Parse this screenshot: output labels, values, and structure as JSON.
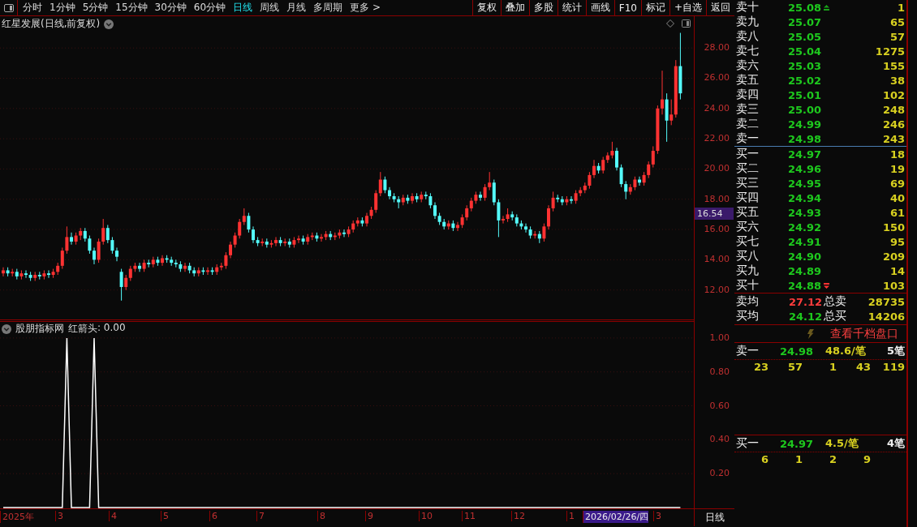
{
  "toolbar": {
    "periods": [
      {
        "label": "分时",
        "selected": false
      },
      {
        "label": "1分钟",
        "selected": false
      },
      {
        "label": "5分钟",
        "selected": false
      },
      {
        "label": "15分钟",
        "selected": false
      },
      {
        "label": "30分钟",
        "selected": false
      },
      {
        "label": "60分钟",
        "selected": false
      },
      {
        "label": "日线",
        "selected": true
      },
      {
        "label": "周线",
        "selected": false
      },
      {
        "label": "月线",
        "selected": false
      },
      {
        "label": "多周期",
        "selected": false
      },
      {
        "label": "更多 >",
        "selected": false
      }
    ],
    "tools": [
      "复权",
      "叠加",
      "多股",
      "统计",
      "画线",
      "F10",
      "标记",
      "+自选",
      "返回"
    ]
  },
  "main_chart": {
    "title": "红星发展(日线,前复权)",
    "price_tag": "16.54",
    "chart_data": {
      "type": "candlestick",
      "grid": true,
      "ylim": [
        10,
        30.1
      ],
      "yticks": [
        {
          "value": 28,
          "label": "28.00"
        },
        {
          "value": 26,
          "label": "26.00"
        },
        {
          "value": 24,
          "label": "24.00"
        },
        {
          "value": 22,
          "label": "22.00"
        },
        {
          "value": 20,
          "label": "20.00"
        },
        {
          "value": 18,
          "label": "18.00"
        },
        {
          "value": 16,
          "label": "16.00"
        },
        {
          "value": 14,
          "label": "14.00"
        },
        {
          "value": 12,
          "label": "12.00"
        }
      ],
      "ohlc": [
        [
          13.1,
          13.5,
          12.9,
          13.3
        ],
        [
          13.3,
          13.5,
          12.9,
          13.1
        ],
        [
          13.1,
          13.4,
          12.9,
          13.2
        ],
        [
          13.2,
          13.4,
          12.7,
          12.9
        ],
        [
          12.9,
          13.3,
          12.7,
          13.1
        ],
        [
          13.1,
          13.3,
          12.8,
          13.0
        ],
        [
          13.0,
          13.2,
          12.6,
          12.8
        ],
        [
          12.8,
          13.2,
          12.6,
          13.0
        ],
        [
          13.0,
          13.2,
          12.7,
          12.9
        ],
        [
          12.9,
          13.3,
          12.7,
          13.1
        ],
        [
          13.1,
          13.3,
          12.8,
          13.0
        ],
        [
          13.0,
          13.4,
          12.8,
          13.2
        ],
        [
          13.2,
          13.8,
          13.0,
          13.6
        ],
        [
          13.6,
          14.8,
          13.4,
          14.6
        ],
        [
          14.6,
          16.2,
          14.4,
          15.5
        ],
        [
          15.5,
          15.8,
          15.0,
          15.2
        ],
        [
          15.2,
          15.8,
          15.0,
          15.6
        ],
        [
          15.6,
          16.1,
          15.3,
          15.9
        ],
        [
          15.9,
          16.1,
          15.2,
          15.4
        ],
        [
          15.4,
          15.6,
          14.4,
          14.6
        ],
        [
          14.6,
          14.8,
          13.7,
          14.0
        ],
        [
          14.0,
          15.4,
          13.8,
          15.2
        ],
        [
          15.2,
          16.7,
          15.0,
          16.1
        ],
        [
          16.1,
          16.3,
          15.1,
          15.3
        ],
        [
          15.3,
          15.5,
          14.4,
          14.6
        ],
        [
          14.6,
          14.8,
          13.9,
          14.2
        ],
        [
          13.2,
          13.4,
          11.3,
          12.2
        ],
        [
          12.2,
          13.0,
          12.0,
          12.8
        ],
        [
          12.8,
          13.6,
          12.6,
          13.4
        ],
        [
          13.4,
          13.8,
          13.2,
          13.6
        ],
        [
          13.6,
          13.8,
          13.2,
          13.4
        ],
        [
          13.4,
          14.0,
          13.2,
          13.8
        ],
        [
          13.8,
          14.0,
          13.5,
          13.7
        ],
        [
          13.7,
          14.2,
          13.5,
          14.0
        ],
        [
          14.0,
          14.2,
          13.6,
          13.8
        ],
        [
          13.8,
          14.3,
          13.6,
          14.1
        ],
        [
          14.1,
          14.3,
          13.8,
          14.0
        ],
        [
          14.0,
          14.2,
          13.6,
          13.8
        ],
        [
          13.8,
          14.0,
          13.5,
          13.7
        ],
        [
          13.7,
          13.9,
          13.2,
          13.4
        ],
        [
          13.4,
          13.8,
          13.2,
          13.6
        ],
        [
          13.6,
          13.8,
          13.1,
          13.3
        ],
        [
          13.3,
          13.5,
          12.9,
          13.1
        ],
        [
          13.1,
          13.5,
          12.9,
          13.3
        ],
        [
          13.3,
          13.5,
          13.0,
          13.2
        ],
        [
          13.2,
          13.5,
          13.0,
          13.3
        ],
        [
          13.3,
          13.5,
          13.0,
          13.2
        ],
        [
          13.2,
          13.7,
          13.0,
          13.5
        ],
        [
          13.5,
          13.8,
          13.3,
          13.6
        ],
        [
          13.6,
          14.5,
          13.4,
          14.3
        ],
        [
          14.3,
          15.2,
          14.1,
          15.0
        ],
        [
          15.0,
          15.8,
          14.8,
          15.6
        ],
        [
          15.6,
          16.7,
          15.4,
          16.5
        ],
        [
          16.5,
          17.4,
          16.3,
          16.9
        ],
        [
          16.9,
          17.1,
          15.8,
          16.0
        ],
        [
          16.0,
          16.2,
          15.1,
          15.3
        ],
        [
          15.3,
          15.5,
          14.9,
          15.1
        ],
        [
          15.1,
          15.4,
          14.9,
          15.2
        ],
        [
          15.2,
          15.4,
          14.8,
          15.0
        ],
        [
          15.0,
          15.3,
          14.8,
          15.1
        ],
        [
          15.1,
          15.5,
          14.9,
          15.3
        ],
        [
          15.3,
          15.5,
          14.9,
          15.1
        ],
        [
          15.1,
          15.4,
          14.9,
          15.2
        ],
        [
          15.2,
          15.4,
          14.8,
          15.0
        ],
        [
          15.0,
          15.5,
          14.8,
          15.3
        ],
        [
          15.3,
          15.6,
          15.1,
          15.4
        ],
        [
          15.4,
          15.6,
          15.0,
          15.2
        ],
        [
          15.2,
          15.7,
          15.0,
          15.5
        ],
        [
          15.5,
          15.8,
          15.3,
          15.6
        ],
        [
          15.6,
          15.8,
          15.2,
          15.4
        ],
        [
          15.4,
          15.7,
          15.2,
          15.5
        ],
        [
          15.5,
          15.9,
          15.3,
          15.7
        ],
        [
          15.7,
          15.9,
          15.3,
          15.5
        ],
        [
          15.5,
          15.8,
          15.3,
          15.6
        ],
        [
          15.6,
          16.0,
          15.4,
          15.8
        ],
        [
          15.8,
          16.0,
          15.5,
          15.7
        ],
        [
          15.7,
          16.2,
          15.5,
          16.0
        ],
        [
          16.0,
          16.6,
          15.8,
          16.4
        ],
        [
          16.4,
          16.8,
          16.2,
          16.6
        ],
        [
          16.6,
          16.8,
          16.2,
          16.4
        ],
        [
          16.4,
          17.1,
          16.2,
          16.9
        ],
        [
          16.9,
          17.5,
          16.7,
          17.3
        ],
        [
          17.3,
          18.6,
          17.1,
          18.4
        ],
        [
          18.4,
          19.8,
          18.2,
          19.3
        ],
        [
          19.3,
          19.5,
          18.4,
          18.6
        ],
        [
          18.6,
          18.8,
          18.0,
          18.2
        ],
        [
          18.2,
          18.4,
          17.8,
          18.0
        ],
        [
          18.0,
          18.2,
          17.4,
          17.8
        ],
        [
          17.8,
          18.3,
          17.6,
          18.1
        ],
        [
          18.1,
          18.3,
          17.7,
          17.9
        ],
        [
          17.9,
          18.4,
          17.7,
          18.2
        ],
        [
          18.2,
          18.4,
          17.8,
          18.0
        ],
        [
          18.0,
          18.5,
          17.8,
          18.3
        ],
        [
          18.3,
          18.5,
          18.0,
          18.2
        ],
        [
          18.2,
          18.4,
          17.4,
          17.6
        ],
        [
          17.6,
          17.8,
          16.7,
          16.9
        ],
        [
          16.9,
          17.1,
          16.3,
          16.5
        ],
        [
          16.5,
          16.7,
          16.0,
          16.2
        ],
        [
          16.2,
          16.6,
          16.0,
          16.4
        ],
        [
          16.4,
          16.6,
          15.9,
          16.1
        ],
        [
          16.1,
          16.5,
          15.9,
          16.3
        ],
        [
          16.3,
          17.0,
          16.1,
          16.8
        ],
        [
          16.8,
          17.6,
          16.6,
          17.4
        ],
        [
          17.4,
          18.1,
          17.2,
          17.9
        ],
        [
          17.9,
          18.5,
          17.7,
          18.3
        ],
        [
          18.3,
          18.5,
          17.9,
          18.1
        ],
        [
          18.1,
          19.0,
          17.9,
          18.8
        ],
        [
          18.8,
          19.8,
          18.6,
          19.1
        ],
        [
          19.1,
          19.3,
          17.6,
          17.8
        ],
        [
          17.8,
          18.0,
          15.5,
          16.6
        ],
        [
          16.6,
          16.9,
          16.4,
          16.7
        ],
        [
          16.7,
          17.4,
          16.5,
          17.0
        ],
        [
          17.0,
          17.2,
          16.6,
          16.8
        ],
        [
          16.8,
          17.0,
          16.2,
          16.4
        ],
        [
          16.4,
          16.6,
          16.0,
          16.2
        ],
        [
          16.2,
          16.4,
          15.8,
          16.0
        ],
        [
          16.0,
          16.2,
          15.4,
          15.6
        ],
        [
          15.6,
          15.9,
          15.4,
          15.7
        ],
        [
          15.7,
          15.9,
          15.1,
          15.4
        ],
        [
          15.4,
          16.4,
          15.2,
          16.2
        ],
        [
          16.2,
          17.6,
          16.0,
          17.4
        ],
        [
          17.4,
          18.5,
          17.2,
          18.1
        ],
        [
          18.1,
          18.3,
          17.8,
          18.0
        ],
        [
          18.0,
          18.2,
          17.6,
          17.8
        ],
        [
          17.8,
          18.2,
          17.6,
          18.0
        ],
        [
          18.0,
          18.2,
          17.7,
          17.9
        ],
        [
          17.9,
          18.6,
          17.7,
          18.4
        ],
        [
          18.4,
          18.8,
          18.2,
          18.6
        ],
        [
          18.6,
          19.1,
          18.4,
          18.9
        ],
        [
          18.9,
          19.8,
          18.7,
          19.6
        ],
        [
          19.6,
          20.6,
          19.4,
          20.2
        ],
        [
          20.2,
          20.4,
          19.7,
          19.9
        ],
        [
          19.9,
          20.8,
          19.7,
          20.6
        ],
        [
          20.6,
          21.1,
          20.4,
          20.9
        ],
        [
          20.9,
          21.8,
          20.7,
          21.2
        ],
        [
          21.2,
          21.4,
          19.9,
          20.1
        ],
        [
          20.1,
          20.3,
          18.8,
          19.0
        ],
        [
          19.0,
          19.2,
          18.0,
          18.5
        ],
        [
          18.5,
          19.0,
          18.3,
          18.8
        ],
        [
          18.8,
          19.5,
          18.6,
          19.3
        ],
        [
          19.3,
          19.5,
          18.9,
          19.1
        ],
        [
          19.1,
          19.8,
          18.9,
          19.6
        ],
        [
          19.6,
          20.5,
          19.4,
          20.3
        ],
        [
          20.3,
          21.5,
          20.1,
          21.2
        ],
        [
          21.2,
          24.2,
          21.0,
          24.0
        ],
        [
          24.0,
          26.5,
          23.6,
          24.6
        ],
        [
          24.6,
          25.0,
          21.8,
          23.2
        ],
        [
          23.2,
          24.6,
          22.9,
          23.6
        ],
        [
          23.6,
          27.2,
          23.4,
          26.8
        ],
        [
          26.8,
          29.0,
          24.6,
          25.0
        ]
      ]
    }
  },
  "indicator": {
    "title": "股朋指标网",
    "reading": ": 0.00",
    "chart_data": {
      "type": "line",
      "grid": true,
      "series": [
        {
          "name": "红箭头",
          "color": "#ffffff",
          "values": [
            0,
            0,
            0,
            0,
            0,
            0,
            0,
            0,
            0,
            0,
            0,
            0,
            0,
            0,
            1,
            0,
            0,
            0,
            0,
            0,
            1,
            0,
            0,
            0,
            0,
            0,
            0,
            0,
            0,
            0,
            0,
            0,
            0,
            0,
            0,
            0,
            0,
            0,
            0,
            0,
            0,
            0,
            0,
            0,
            0,
            0,
            0,
            0,
            0,
            0,
            0,
            0,
            0,
            0,
            0,
            0,
            0,
            0,
            0,
            0,
            0,
            0,
            0,
            0,
            0,
            0,
            0,
            0,
            0,
            0,
            0,
            0,
            0,
            0,
            0,
            0,
            0,
            0,
            0,
            0,
            0,
            0,
            0,
            0,
            0,
            0,
            0,
            0,
            0,
            0,
            0,
            0,
            0,
            0,
            0,
            0,
            0,
            0,
            0,
            0,
            0,
            0,
            0,
            0,
            0,
            0,
            0,
            0,
            0,
            0,
            0,
            0,
            0,
            0,
            0,
            0,
            0,
            0,
            0,
            0,
            0,
            0,
            0,
            0,
            0,
            0,
            0,
            0,
            0,
            0,
            0,
            0,
            0,
            0,
            0,
            0,
            0,
            0,
            0,
            0,
            0,
            0,
            0,
            0,
            0,
            0,
            0,
            0,
            0,
            0
          ]
        }
      ],
      "ylim": [
        -0.11,
        1.1
      ],
      "yticks": [
        {
          "value": 1,
          "label": "1.00"
        },
        {
          "value": 0.8,
          "label": "0.80"
        },
        {
          "value": 0.6,
          "label": "0.60"
        },
        {
          "value": 0.4,
          "label": "0.40"
        },
        {
          "value": 0.2,
          "label": "0.20"
        }
      ]
    }
  },
  "x_axis": {
    "labels": [
      {
        "label": "2025年",
        "selected": false
      },
      {
        "label": "3",
        "selected": false
      },
      {
        "label": "4",
        "selected": false
      },
      {
        "label": "5",
        "selected": false
      },
      {
        "label": "6",
        "selected": false
      },
      {
        "label": "7",
        "selected": false
      },
      {
        "label": "8",
        "selected": false
      },
      {
        "label": "9",
        "selected": false
      },
      {
        "label": "10",
        "selected": false
      },
      {
        "label": "11",
        "selected": false
      },
      {
        "label": "12",
        "selected": false
      },
      {
        "label": "1",
        "selected": false
      },
      {
        "label": "2026/02/26/四",
        "selected": true
      },
      {
        "label": "3",
        "selected": false
      }
    ],
    "period": "日线"
  },
  "order_book": {
    "asks": [
      {
        "kind": "up",
        "label": "卖十",
        "price": "25.08",
        "volume": "1"
      },
      {
        "kind": "plain",
        "label": "卖九",
        "price": "25.07",
        "volume": "65"
      },
      {
        "kind": "plain",
        "label": "卖八",
        "price": "25.05",
        "volume": "57"
      },
      {
        "kind": "plain",
        "label": "卖七",
        "price": "25.04",
        "volume": "1275"
      },
      {
        "kind": "plain",
        "label": "卖六",
        "price": "25.03",
        "volume": "155"
      },
      {
        "kind": "plain",
        "label": "卖五",
        "price": "25.02",
        "volume": "38"
      },
      {
        "kind": "plain",
        "label": "卖四",
        "price": "25.01",
        "volume": "102"
      },
      {
        "kind": "plain",
        "label": "卖三",
        "price": "25.00",
        "volume": "248"
      },
      {
        "kind": "plain",
        "label": "卖二",
        "price": "24.99",
        "volume": "246"
      },
      {
        "kind": "plain",
        "label": "卖一",
        "price": "24.98",
        "volume": "243"
      }
    ],
    "bids": [
      {
        "kind": "plain",
        "label": "买一",
        "price": "24.97",
        "volume": "18"
      },
      {
        "kind": "plain",
        "label": "买二",
        "price": "24.96",
        "volume": "19"
      },
      {
        "kind": "plain",
        "label": "买三",
        "price": "24.95",
        "volume": "69"
      },
      {
        "kind": "plain",
        "label": "买四",
        "price": "24.94",
        "volume": "40"
      },
      {
        "kind": "plain",
        "label": "买五",
        "price": "24.93",
        "volume": "61"
      },
      {
        "kind": "plain",
        "label": "买六",
        "price": "24.92",
        "volume": "150"
      },
      {
        "kind": "plain",
        "label": "买七",
        "price": "24.91",
        "volume": "95"
      },
      {
        "kind": "plain",
        "label": "买八",
        "price": "24.90",
        "volume": "209"
      },
      {
        "kind": "plain",
        "label": "买九",
        "price": "24.89",
        "volume": "14"
      },
      {
        "kind": "down",
        "label": "买十",
        "price": "24.88",
        "volume": "103"
      }
    ],
    "averages": [
      {
        "label": "卖均",
        "price": "27.12",
        "color": "#ff3c3c",
        "total_label": "总卖",
        "total": "28735"
      },
      {
        "label": "买均",
        "price": "24.12",
        "color": "#1ec81e",
        "total_label": "总买",
        "total": "14206"
      }
    ],
    "depth_link": "查看千档盘口",
    "queues": [
      {
        "label": "卖一",
        "price": "24.98",
        "avg": "48.6/笔",
        "count": "5笔",
        "orders": [
          "23",
          "57",
          "1",
          "43",
          "119"
        ]
      },
      {
        "label": "买一",
        "price": "24.97",
        "avg": "4.5/笔",
        "count": "4笔",
        "orders": [
          "6",
          "1",
          "2",
          "9"
        ]
      }
    ]
  }
}
